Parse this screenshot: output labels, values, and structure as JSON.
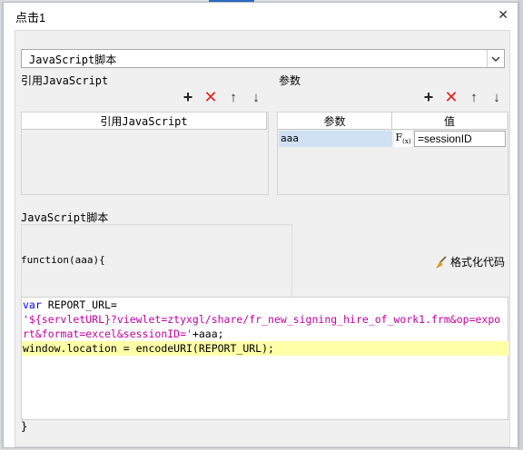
{
  "window": {
    "title": "点击1",
    "close_label": "✕"
  },
  "type_select": {
    "value": "JavaScript脚本"
  },
  "ref_section": {
    "label": "引用JavaScript",
    "header": "引用JavaScript"
  },
  "param_section": {
    "label": "参数",
    "headers": {
      "name": "参数",
      "value": "值"
    },
    "rows": [
      {
        "name": "aaa",
        "value": "=sessionID"
      }
    ]
  },
  "toolbar": {
    "add": "+",
    "delete": "✕",
    "up": "↑",
    "down": "↓",
    "fx": "F",
    "fx_sub": "(x)"
  },
  "script_section": {
    "label": "JavaScript脚本",
    "function_signature": "function(aaa){",
    "format_button": "格式化代码",
    "code": {
      "line1_kw": "var",
      "line1_rest": " REPORT_URL=",
      "line2": "'${servletURL}?viewlet=ztyxgl/share/fr_new_signing_hire_of_work1.frm&op=expo",
      "line3_str": "rt&format=excel&sessionID='",
      "line3_rest": "+aaa;",
      "line4": "window.location = encodeURI(REPORT_URL);"
    },
    "closing_brace": "}"
  }
}
